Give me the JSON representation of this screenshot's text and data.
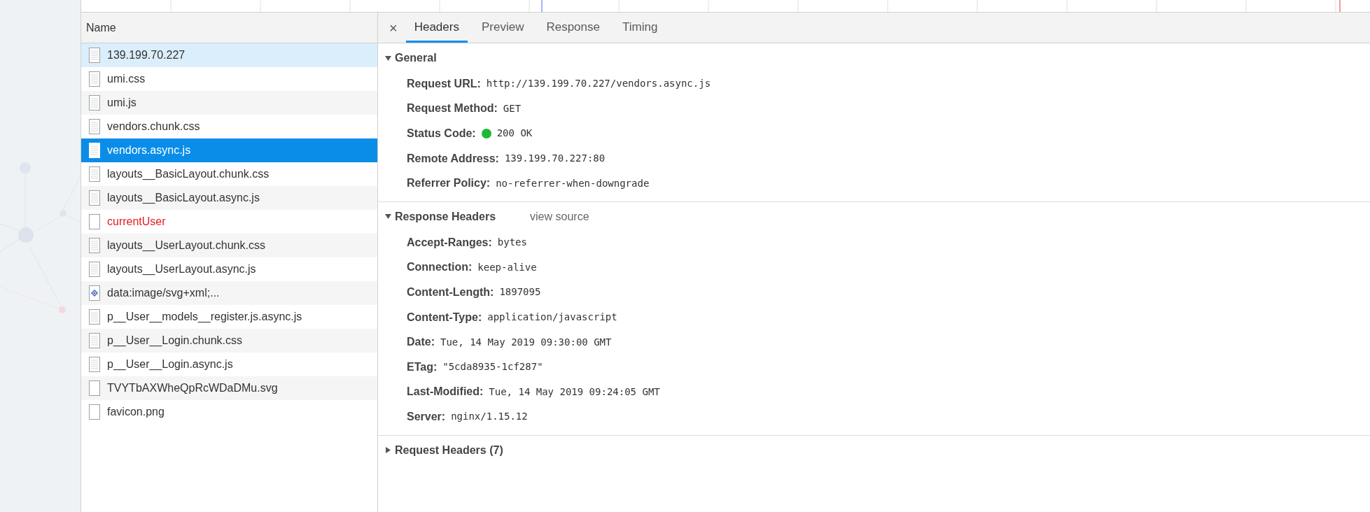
{
  "requests": {
    "column": "Name",
    "items": [
      {
        "name": "139.199.70.227",
        "kind": "document",
        "selected": false,
        "hovered": true,
        "failed": false
      },
      {
        "name": "umi.css",
        "kind": "document",
        "selected": false,
        "hovered": false,
        "failed": false
      },
      {
        "name": "umi.js",
        "kind": "document",
        "selected": false,
        "hovered": false,
        "failed": false
      },
      {
        "name": "vendors.chunk.css",
        "kind": "document",
        "selected": false,
        "hovered": false,
        "failed": false
      },
      {
        "name": "vendors.async.js",
        "kind": "document",
        "selected": true,
        "hovered": false,
        "failed": false
      },
      {
        "name": "layouts__BasicLayout.chunk.css",
        "kind": "document",
        "selected": false,
        "hovered": false,
        "failed": false
      },
      {
        "name": "layouts__BasicLayout.async.js",
        "kind": "document",
        "selected": false,
        "hovered": false,
        "failed": false
      },
      {
        "name": "currentUser",
        "kind": "blank",
        "selected": false,
        "hovered": false,
        "failed": true
      },
      {
        "name": "layouts__UserLayout.chunk.css",
        "kind": "document",
        "selected": false,
        "hovered": false,
        "failed": false
      },
      {
        "name": "layouts__UserLayout.async.js",
        "kind": "document",
        "selected": false,
        "hovered": false,
        "failed": false
      },
      {
        "name": "data:image/svg+xml;...",
        "kind": "image",
        "selected": false,
        "hovered": false,
        "failed": false
      },
      {
        "name": "p__User__models__register.js.async.js",
        "kind": "document",
        "selected": false,
        "hovered": false,
        "failed": false
      },
      {
        "name": "p__User__Login.chunk.css",
        "kind": "document",
        "selected": false,
        "hovered": false,
        "failed": false
      },
      {
        "name": "p__User__Login.async.js",
        "kind": "document",
        "selected": false,
        "hovered": false,
        "failed": false
      },
      {
        "name": "TVYTbAXWheQpRcWDaDMu.svg",
        "kind": "blank",
        "selected": false,
        "hovered": false,
        "failed": false
      },
      {
        "name": "favicon.png",
        "kind": "blank",
        "selected": false,
        "hovered": false,
        "failed": false
      }
    ]
  },
  "detail": {
    "close": "×",
    "tabs": [
      {
        "label": "Headers",
        "selected": true
      },
      {
        "label": "Preview",
        "selected": false
      },
      {
        "label": "Response",
        "selected": false
      },
      {
        "label": "Timing",
        "selected": false
      }
    ],
    "sections": [
      {
        "title": "General",
        "expanded": true,
        "rows": [
          {
            "kind": "plain",
            "name": "Request URL:",
            "value": "http://139.199.70.227/vendors.async.js"
          },
          {
            "kind": "plain",
            "name": "Request Method:",
            "value": "GET"
          },
          {
            "kind": "status",
            "name": "Status Code:",
            "value": "200 OK",
            "color": "#1db934"
          },
          {
            "kind": "plain",
            "name": "Remote Address:",
            "value": "139.199.70.227:80"
          },
          {
            "kind": "plain",
            "name": "Referrer Policy:",
            "value": "no-referrer-when-downgrade"
          }
        ]
      },
      {
        "title": "Response Headers",
        "link": "view source",
        "expanded": true,
        "rows": [
          {
            "kind": "plain",
            "name": "Accept-Ranges:",
            "value": "bytes"
          },
          {
            "kind": "plain",
            "name": "Connection:",
            "value": "keep-alive"
          },
          {
            "kind": "plain",
            "name": "Content-Length:",
            "value": "1897095"
          },
          {
            "kind": "plain",
            "name": "Content-Type:",
            "value": "application/javascript"
          },
          {
            "kind": "plain",
            "name": "Date:",
            "value": "Tue, 14 May 2019 09:30:00 GMT"
          },
          {
            "kind": "plain",
            "name": "ETag:",
            "value": "\"5cda8935-1cf287\""
          },
          {
            "kind": "plain",
            "name": "Last-Modified:",
            "value": "Tue, 14 May 2019 09:24:05 GMT"
          },
          {
            "kind": "plain",
            "name": "Server:",
            "value": "nginx/1.15.12"
          }
        ]
      },
      {
        "title": "Request Headers (7)",
        "expanded": false
      }
    ]
  }
}
